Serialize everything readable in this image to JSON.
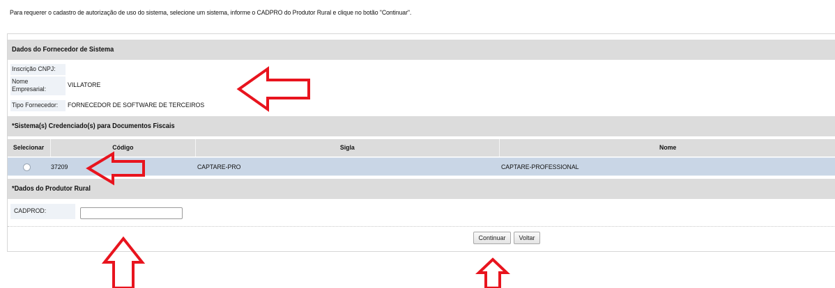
{
  "intro_text": "Para requerer o cadastro de autorização de uso do sistema, selecione um sistema, informe o CADPRO do Produtor Rural e clique no botão \"Continuar\".",
  "fornecedor": {
    "header": "Dados do Fornecedor de Sistema",
    "cnpj_label": "Inscrição CNPJ:",
    "cnpj_value": "",
    "nome_label_line1": "Nome",
    "nome_label_line2": "Empresarial:",
    "nome_value": "VILLATORE",
    "tipo_label": "Tipo Fornecedor:",
    "tipo_value": "FORNECEDOR DE SOFTWARE DE TERCEIROS"
  },
  "sistemas": {
    "header": "*Sistema(s) Credenciado(s) para Documentos Fiscais",
    "columns": [
      "Selecionar",
      "Código",
      "Sigla",
      "Nome"
    ],
    "rows": [
      {
        "codigo": "37209",
        "sigla": "CAPTARE-PRO",
        "nome": "CAPTARE-PROFESSIONAL",
        "selected": false
      }
    ]
  },
  "produtor": {
    "header": "*Dados do Produtor Rural",
    "cadprod_label": "CADPROD:",
    "cadprod_value": ""
  },
  "buttons": {
    "continuar": "Continuar",
    "voltar": "Voltar"
  },
  "colors": {
    "annotation_arrow": "#e8141e",
    "section_header_bg": "#dcdcdc",
    "selected_row_bg": "#c9d6e6"
  },
  "annotations": [
    "arrow-left",
    "arrow-left",
    "arrow-up",
    "arrow-up"
  ]
}
